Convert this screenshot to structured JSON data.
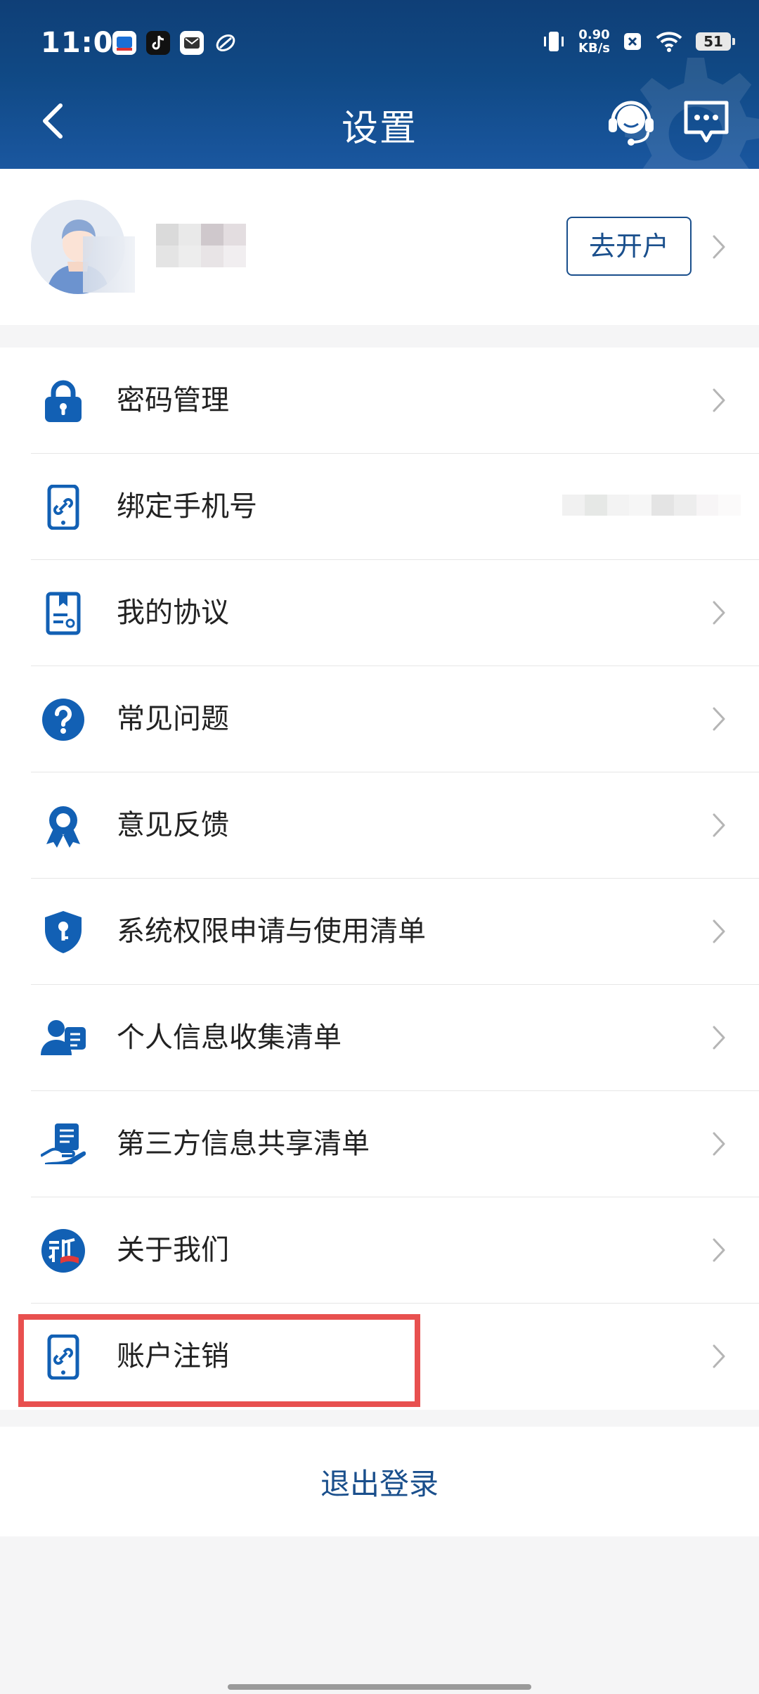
{
  "status_bar": {
    "time": "11:01",
    "speed_value": "0.90",
    "speed_unit": "KB/s",
    "battery": "51"
  },
  "header": {
    "title": "设置"
  },
  "profile": {
    "open_account_label": "去开户"
  },
  "settings": {
    "items": [
      {
        "label": "密码管理",
        "icon": "lock-icon"
      },
      {
        "label": "绑定手机号",
        "icon": "phone-link-icon"
      },
      {
        "label": "我的协议",
        "icon": "agreement-icon"
      },
      {
        "label": "常见问题",
        "icon": "question-icon"
      },
      {
        "label": "意见反馈",
        "icon": "award-ribbon-icon"
      },
      {
        "label": "系统权限申请与使用清单",
        "icon": "shield-key-icon"
      },
      {
        "label": "个人信息收集清单",
        "icon": "user-card-icon"
      },
      {
        "label": "第三方信息共享清单",
        "icon": "hand-document-icon"
      },
      {
        "label": "关于我们",
        "icon": "brand-logo-icon"
      },
      {
        "label": "账户注销",
        "icon": "phone-link-icon"
      }
    ]
  },
  "logout": {
    "label": "退出登录"
  },
  "colors": {
    "brand_blue": "#1a4f8c",
    "icon_blue": "#1260b4",
    "highlight_red": "#e8504f"
  }
}
